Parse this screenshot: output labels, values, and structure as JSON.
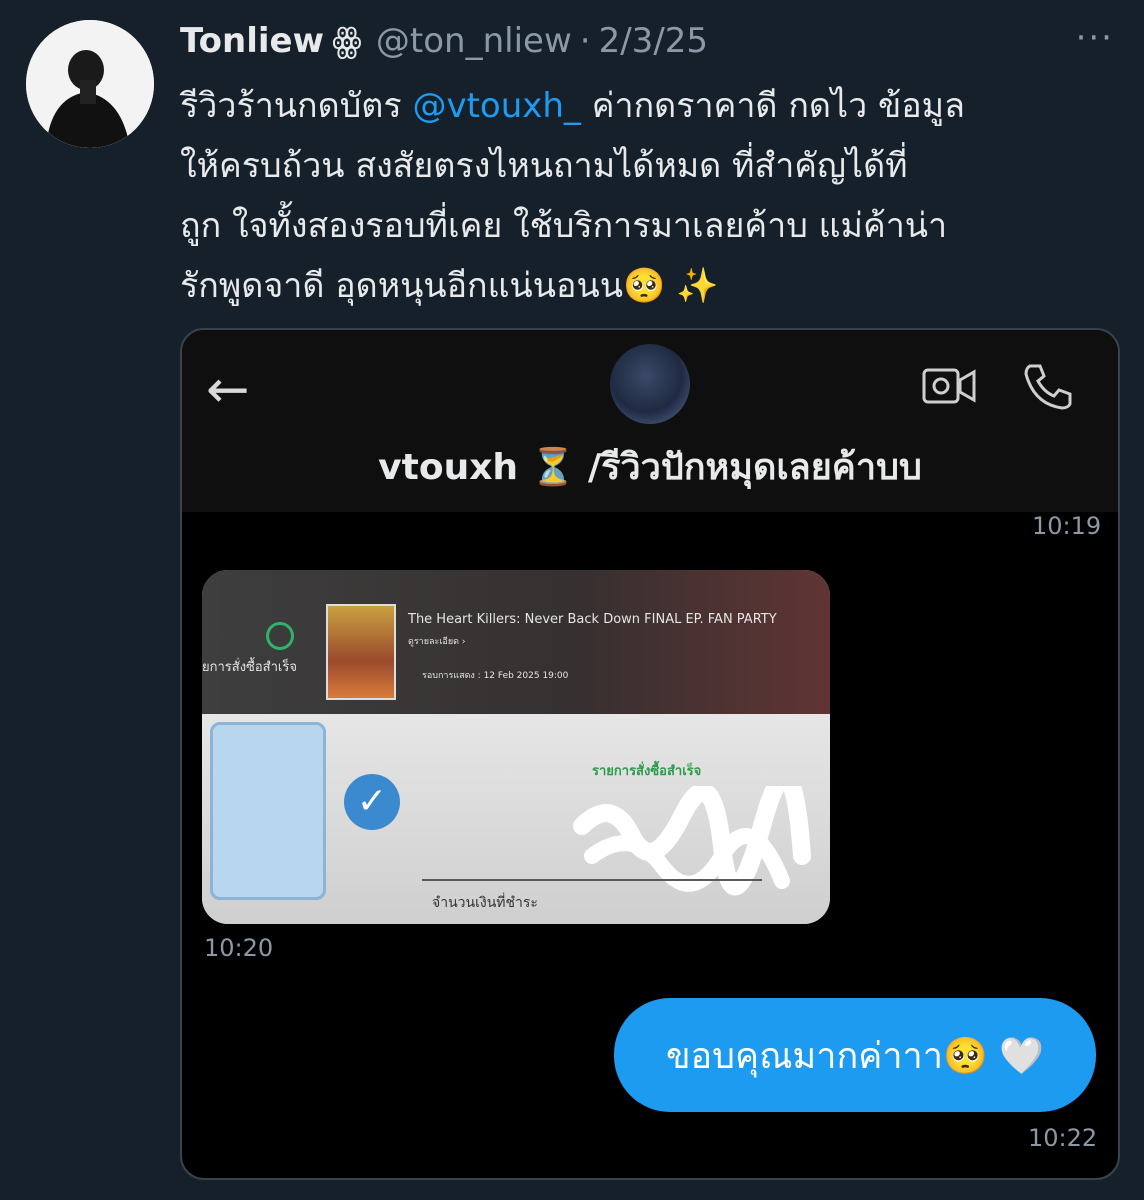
{
  "tweet": {
    "author_name": "Tonliew",
    "author_badge": "ꙮ",
    "handle": "@ton_nliew",
    "separator": "·",
    "date": "2/3/25",
    "more_icon": "···",
    "text_line1_start": "รีวิวร้านกดบัตร ",
    "mention": "@vtouxh_",
    "text_line1_end": "  ค่ากดราคาดี กดไว ข้อมูล",
    "text_line2": "ให้ครบถ้วน สงสัยตรงไหนถามได้หมด ที่สำคัญได้ที่",
    "text_line3": "ถูก ใจทั้งสองรอบที่เคย ใช้บริการมาเลยค้าบ แม่ค้าน่า",
    "text_line4": "รักพูดจาดี อุดหนุนอีกแน่นอนน🥺 ✨"
  },
  "dm": {
    "back_icon": "←",
    "title": "vtouxh ⏳ /รีวิวปักหมุดเลยค้าบบ",
    "time1": "10:19",
    "time2": "10:20",
    "time3": "10:22",
    "photo": {
      "status_left": "ยการสั่งซื้อสำเร็จ",
      "event_title": "The Heart Killers: Never Back Down FINAL EP. FAN PARTY",
      "detail_link": "ดูรายละเอียด ›",
      "show_date": "รอบการแสดง  : 12 Feb 2025 19:00",
      "success_label": "รายการสั่งซื้อสำเร็จ",
      "amount_label": "จำนวนเงินที่ชำระ"
    },
    "message": "ขอบคุณมากค่าาา🥺 🤍"
  },
  "colors": {
    "background": "#15202b",
    "accent": "#1d9bf0",
    "muted": "#8b98a5"
  }
}
